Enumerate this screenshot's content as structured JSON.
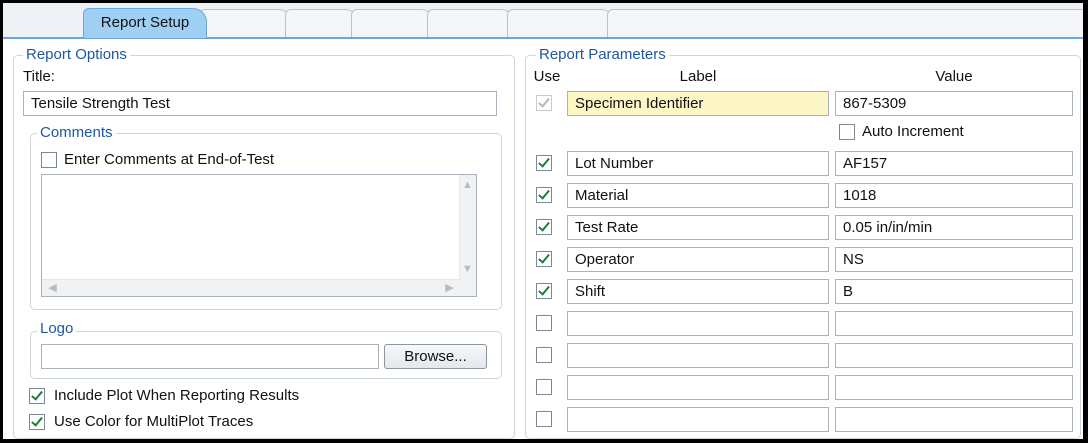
{
  "tabs": [
    {
      "label": "Report Setup",
      "active": true
    },
    {
      "label": ""
    },
    {
      "label": ""
    },
    {
      "label": ""
    },
    {
      "label": ""
    },
    {
      "label": ""
    },
    {
      "label": ""
    }
  ],
  "report_options": {
    "legend": "Report Options",
    "title_label": "Title:",
    "title_value": "Tensile Strength Test",
    "comments": {
      "legend": "Comments",
      "enter_at_end_label": "Enter Comments at End-of-Test",
      "enter_at_end_checked": false,
      "text": ""
    },
    "logo": {
      "legend": "Logo",
      "path": "",
      "browse_label": "Browse..."
    },
    "include_plot_label": "Include Plot When Reporting Results",
    "include_plot_checked": true,
    "use_color_label": "Use Color for MultiPlot Traces",
    "use_color_checked": true
  },
  "report_parameters": {
    "legend": "Report Parameters",
    "col_use": "Use",
    "col_label": "Label",
    "col_value": "Value",
    "auto_increment_label": "Auto Increment",
    "auto_increment_checked": false,
    "rows": [
      {
        "use": true,
        "label": "Specimen Identifier",
        "value": "867-5309"
      },
      {
        "use": true,
        "label": "Lot Number",
        "value": "AF157"
      },
      {
        "use": true,
        "label": "Material",
        "value": "1018"
      },
      {
        "use": true,
        "label": "Test Rate",
        "value": "0.05 in/in/min"
      },
      {
        "use": true,
        "label": "Operator",
        "value": "NS"
      },
      {
        "use": true,
        "label": "Shift",
        "value": "B"
      },
      {
        "use": false,
        "label": "",
        "value": ""
      },
      {
        "use": false,
        "label": "",
        "value": ""
      },
      {
        "use": false,
        "label": "",
        "value": ""
      },
      {
        "use": false,
        "label": "",
        "value": ""
      }
    ]
  }
}
